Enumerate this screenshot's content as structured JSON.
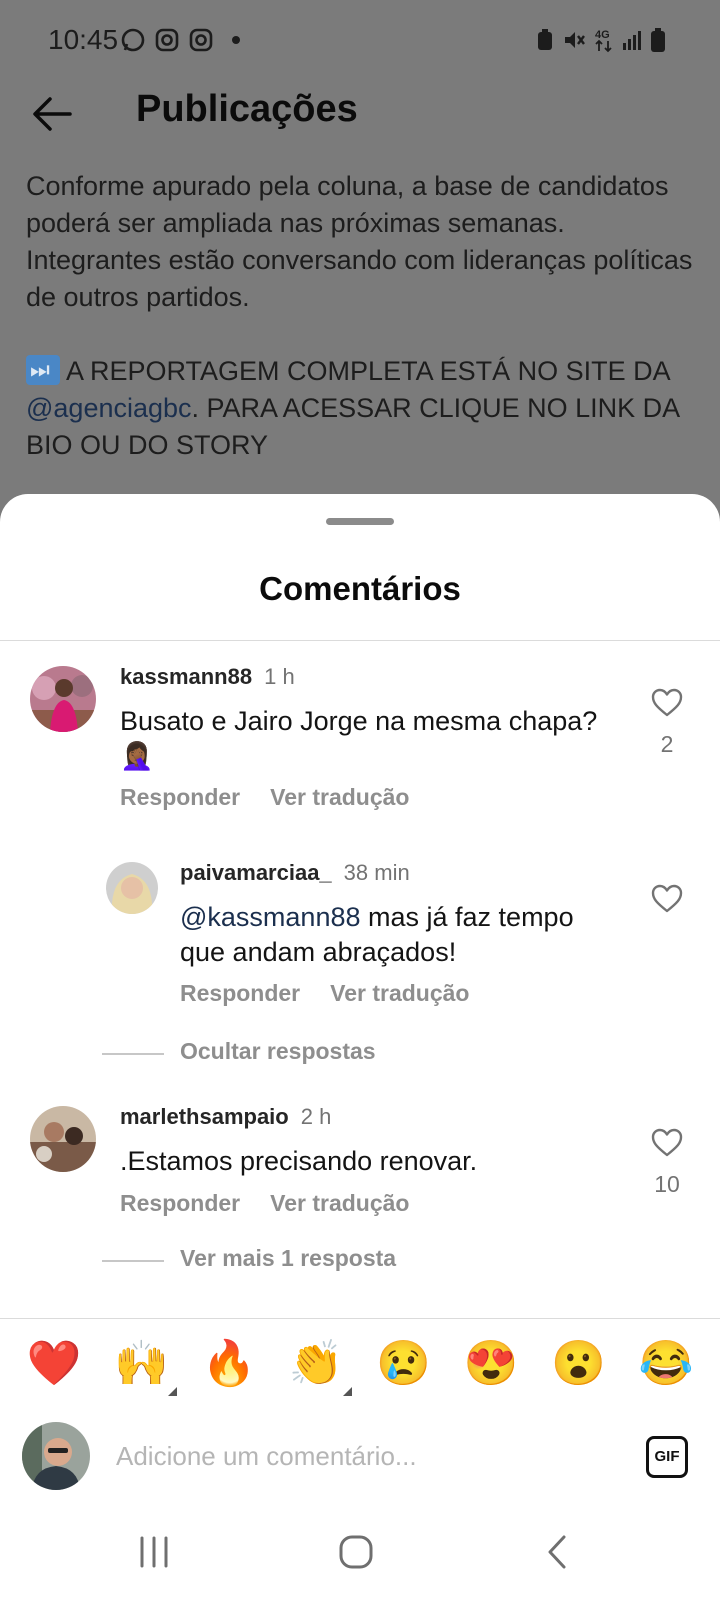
{
  "status_bar": {
    "time": "10:45"
  },
  "topbar": {
    "title": "Publicações"
  },
  "post": {
    "caption_p1": "Conforme apurado pela coluna, a base de candidatos poderá ser ampliada nas próximas semanas. Integrantes estão conversando com lideranças políticas de outros partidos.",
    "caption_p2_pre": "A REPORTAGEM COMPLETA ESTÁ NO SITE DA",
    "caption_p2_mention": "@agenciagbc",
    "caption_p2_post": ". PARA ACESSAR CLIQUE NO LINK DA BIO OU DO STORY"
  },
  "sheet": {
    "title": "Comentários"
  },
  "comments": [
    {
      "user": "kassmann88",
      "time": "1 h",
      "text": "Busato e Jairo Jorge na mesma chapa? 🤦🏾‍♀️",
      "reply": "Responder",
      "translate": "Ver tradução",
      "likes": "2"
    },
    {
      "user": "paivamarciaa_",
      "time": "38 min",
      "mention": "@kassmann88",
      "text": " mas já faz tempo que andam abraçados!",
      "reply": "Responder",
      "translate": "Ver tradução",
      "likes": ""
    },
    {
      "user": "marlethsampaio",
      "time": "2 h",
      "text": ".Estamos precisando renovar.",
      "reply": "Responder",
      "translate": "Ver tradução",
      "likes": "10"
    }
  ],
  "threads": {
    "hide_replies": "Ocultar respostas",
    "more_replies": "Ver mais 1 resposta"
  },
  "emoji_bar": [
    "❤️",
    "🙌",
    "🔥",
    "👏",
    "😢",
    "😍",
    "😮",
    "😂"
  ],
  "composer": {
    "placeholder": "Adicione um comentário...",
    "gif_label": "GIF"
  },
  "icons": {
    "back": "arrow-left-icon",
    "like": "heart-outline-icon",
    "nav_recent": "recent-apps-icon",
    "nav_home": "home-icon",
    "nav_back": "chevron-left-icon"
  }
}
